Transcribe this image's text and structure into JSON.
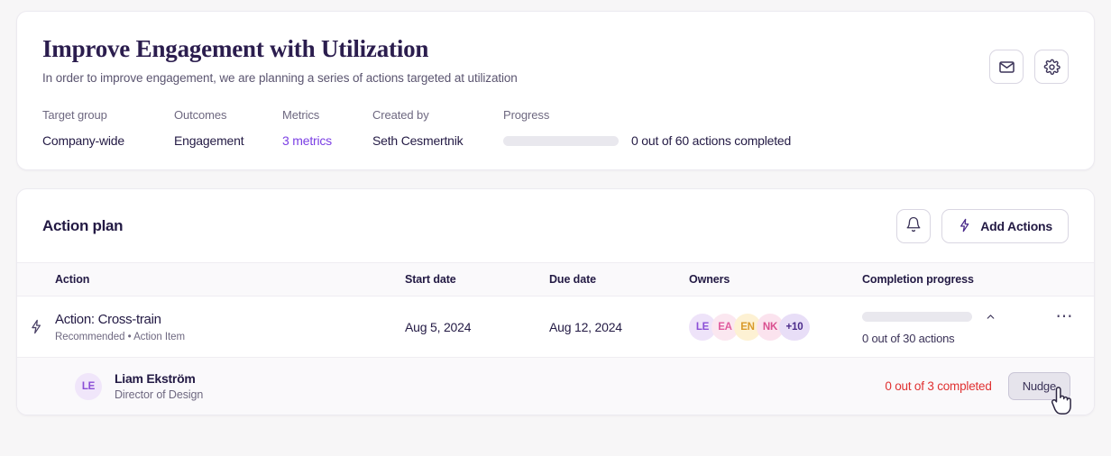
{
  "overview": {
    "title": "Improve Engagement with Utilization",
    "subtitle": "In order to improve engagement, we are planning a series of actions targeted at utilization",
    "meta": {
      "target_group": {
        "label": "Target group",
        "value": "Company-wide"
      },
      "outcomes": {
        "label": "Outcomes",
        "value": "Engagement"
      },
      "metrics": {
        "label": "Metrics",
        "value": "3 metrics"
      },
      "created_by": {
        "label": "Created by",
        "value": "Seth Cesmertnik"
      },
      "progress": {
        "label": "Progress",
        "text": "0 out of 60 actions completed",
        "percent": 0
      }
    },
    "buttons": {
      "message": "message-icon",
      "settings": "gear-icon"
    }
  },
  "action_plan": {
    "title": "Action plan",
    "notifications_button": "bell-icon",
    "add_actions_button": "Add Actions",
    "columns": [
      "Action",
      "Start date",
      "Due date",
      "Owners",
      "Completion progress"
    ],
    "rows": [
      {
        "icon": "lightning-bolt-icon",
        "title": "Action: Cross-train",
        "subtitle": "Recommended • Action Item",
        "start_date": "Aug 5, 2024",
        "due_date": "Aug 12, 2024",
        "owners": [
          {
            "initials": "LE",
            "bg": "#eee3f9",
            "fg": "#8b4fd6"
          },
          {
            "initials": "EA",
            "bg": "#fbe7f0",
            "fg": "#e05c9e"
          },
          {
            "initials": "EN",
            "bg": "#fdf1d3",
            "fg": "#d99a2b"
          },
          {
            "initials": "NK",
            "bg": "#fbe3ee",
            "fg": "#d94f8f"
          },
          {
            "initials": "+10",
            "bg": "#e8def7",
            "fg": "#4a2a8a"
          }
        ],
        "progress_text": "0 out of 30 actions",
        "progress_percent": 0,
        "expanded": true,
        "more_menu": "kebab-menu-icon",
        "members": [
          {
            "initials": "LE",
            "avatar_bg": "#f0e6fa",
            "avatar_fg": "#8b4fd6",
            "name": "Liam Ekström",
            "role": "Director of Design",
            "status": "0 out of 3 completed",
            "action_label": "Nudge"
          }
        ]
      }
    ]
  },
  "colors": {
    "accent": "#7b3fe4",
    "title": "#2b1d4e",
    "danger": "#e03131",
    "track": "#e9e8ee"
  }
}
